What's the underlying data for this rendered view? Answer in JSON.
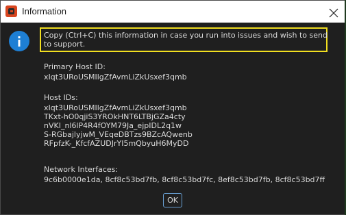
{
  "window": {
    "title": "Information",
    "app_icon": "app-logo-icon",
    "close_icon": "close-icon"
  },
  "message": {
    "info_icon": "info-icon",
    "intro": "Copy (Ctrl+C) this information in case you run into issues and wish to send to support.",
    "primary_host_label": "Primary Host ID:",
    "primary_host_value": "xIqt3URoUSMIlgZfAvmLiZkUsxef3qmb",
    "host_ids_label": "Host IDs:",
    "host_ids": [
      "xIqt3URoUSMIlgZfAvmLiZkUsxef3qmb",
      "TKxt-hO0qjiS3YROkHNT6LTBjGZa4cty",
      "nVKI_nl6lP4R4fOYM79Ja_ejpIDL2q1w",
      "S-RGbajlyjwM_VEqeDBTzs9BZcAQwenb",
      "RFpfzK-_KfcfAZUDJrYI5mQbyuH6MyDD"
    ],
    "network_label": "Network Interfaces:",
    "network_value": "9c6b0000e1da, 8cf8c53bd7fb, 8cf8c53bd7fc, 8ef8c53bd7fb, 8cf8c53bd7ff"
  },
  "buttons": {
    "ok_label": "OK"
  },
  "colors": {
    "highlight_border": "#f2df20",
    "info_icon": "#1e7fd4",
    "ok_border": "#6aa2d6"
  }
}
